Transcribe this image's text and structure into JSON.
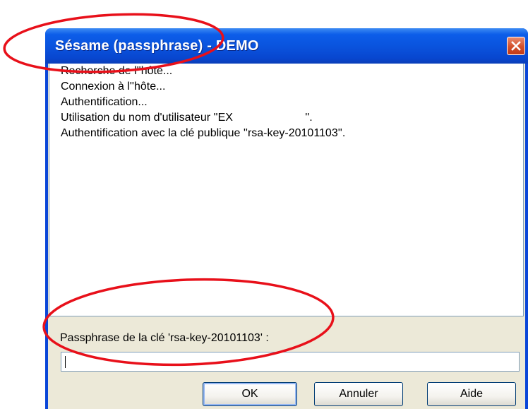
{
  "window": {
    "title": "Sésame (passphrase) - DEMO",
    "close_icon": "close-icon"
  },
  "log": {
    "lines": [
      "Recherche de l''hôte...",
      "Connexion à l''hôte...",
      "Authentification...",
      "Utilisation du nom d'utilisateur ''EX                       ''.",
      "Authentification avec la clé publique ''rsa-key-20101103''."
    ]
  },
  "prompt": {
    "label": "Passphrase de la clé 'rsa-key-20101103' :",
    "value": ""
  },
  "buttons": {
    "ok": "OK",
    "cancel": "Annuler",
    "help": "Aide"
  },
  "colors": {
    "annotation": "#e8101a",
    "titlebar": "#0a52dc",
    "dialog_bg": "#ece9d8"
  }
}
